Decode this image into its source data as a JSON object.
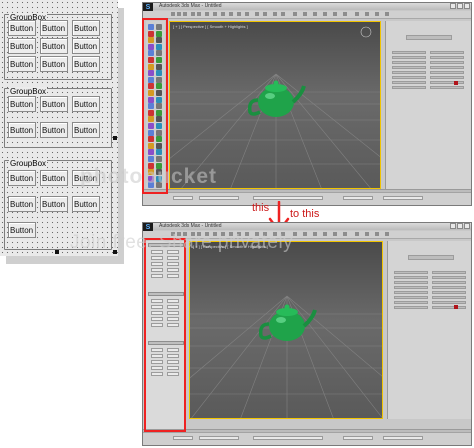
{
  "designer": {
    "group_title": "GroupBox",
    "button_label": "Button",
    "groups": [
      {
        "title": "GroupBox",
        "rows": 3,
        "cols": 3
      },
      {
        "title": "GroupBox",
        "rows": 2,
        "cols": 3
      },
      {
        "title": "GroupBox",
        "rows": 3,
        "cols": 3
      }
    ]
  },
  "annotation": {
    "from_label": "this",
    "to_label": "to this",
    "arrow_color": "#ee2222"
  },
  "watermark": {
    "top": "photobucket",
    "bottom": "Join free. Share privately"
  },
  "colors": {
    "highlight_box": "#ee2222",
    "teapot": "#1fa34a",
    "viewport_border": "#f1c400",
    "accent_swatch": "#b0141b"
  },
  "max_window": {
    "logo_icon": "3ds-max-icon",
    "title_text": "Autodesk 3ds Max - Untitled",
    "viewport_label": "[ + ] [ Perspective ] [ Smooth + Highlights ]",
    "model": "teapot"
  }
}
